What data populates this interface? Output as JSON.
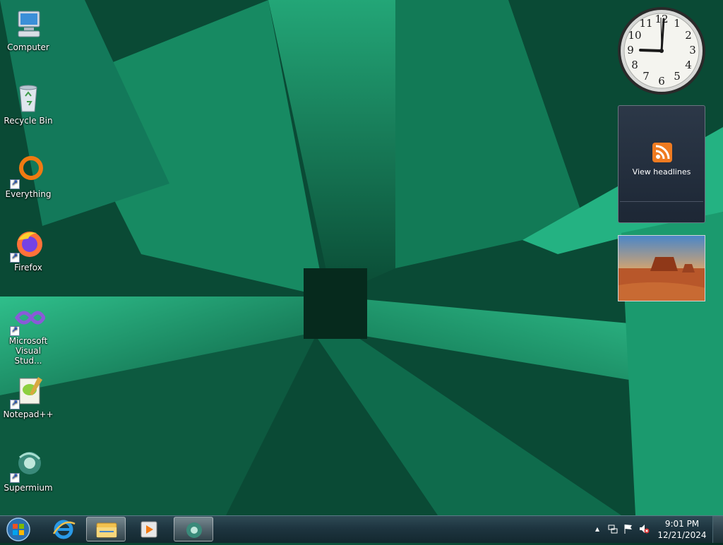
{
  "desktop": {
    "icons": [
      {
        "label": "Computer",
        "icon": "computer-icon"
      },
      {
        "label": "Recycle Bin",
        "icon": "recycle-bin-icon"
      },
      {
        "label": "Everything",
        "icon": "everything-icon"
      },
      {
        "label": "Firefox",
        "icon": "firefox-icon"
      },
      {
        "label": "Microsoft Visual Stud...",
        "icon": "visual-studio-icon"
      },
      {
        "label": "Notepad++",
        "icon": "notepadplusplus-icon"
      },
      {
        "label": "Supermium",
        "icon": "supermium-icon"
      }
    ]
  },
  "gadgets": {
    "clock": {
      "time": "9:01",
      "numerals": [
        "12",
        "1",
        "2",
        "3",
        "4",
        "5",
        "6",
        "7",
        "8",
        "9",
        "10",
        "11"
      ]
    },
    "feed": {
      "label": "View headlines",
      "icon": "rss-icon"
    },
    "slideshow": {
      "icon": "slideshow-desert-image"
    }
  },
  "taskbar": {
    "start_icon": "windows-start-icon",
    "pinned": [
      {
        "icon": "internet-explorer-icon"
      },
      {
        "icon": "file-explorer-icon"
      },
      {
        "icon": "media-player-icon"
      },
      {
        "icon": "supermium-taskbar-icon"
      }
    ],
    "tray": {
      "icons": [
        "show-hidden-icons-icon",
        "network-icon",
        "action-center-flag-icon",
        "volume-muted-icon"
      ],
      "time": "9:01 PM",
      "date": "12/21/2024"
    }
  },
  "colors": {
    "taskbar": "#1e3540",
    "rss_orange": "#ef7b21",
    "wallpaper_green": "#1a8a66"
  }
}
